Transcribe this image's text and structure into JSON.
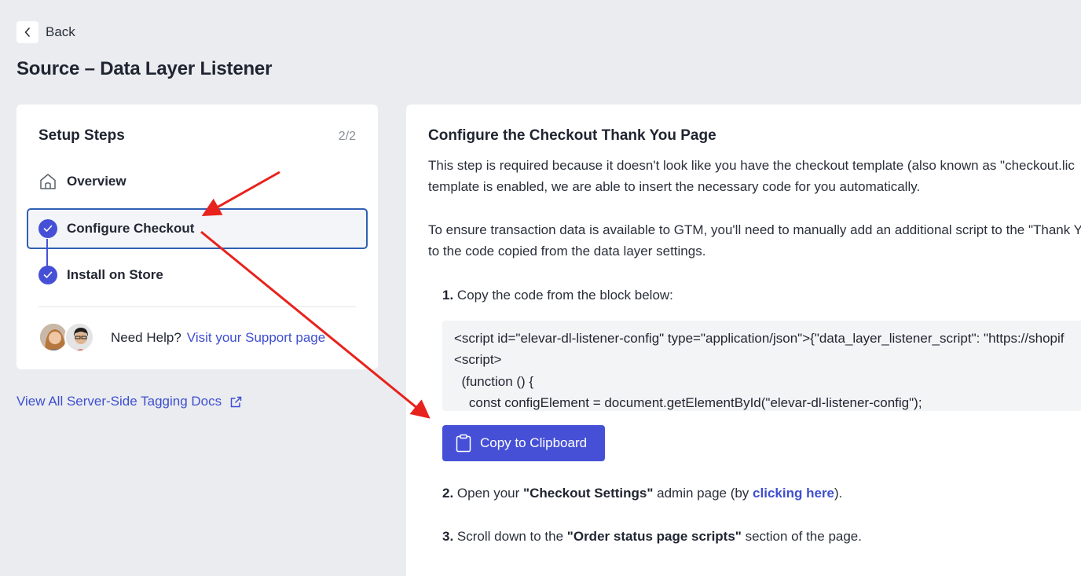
{
  "header": {
    "back_label": "Back",
    "page_title": "Source – Data Layer Listener"
  },
  "sidebar": {
    "title": "Setup Steps",
    "progress": "2/2",
    "steps": [
      {
        "label": "Overview",
        "icon": "home-icon",
        "state": "default"
      },
      {
        "label": "Configure Checkout",
        "icon": "check-circle-icon",
        "state": "active"
      },
      {
        "label": "Install on Store",
        "icon": "check-circle-icon",
        "state": "complete"
      }
    ],
    "help_text": "Need Help?",
    "help_link": "Visit your Support page",
    "docs_link": "View All Server-Side Tagging Docs"
  },
  "main": {
    "title": "Configure the Checkout Thank You Page",
    "para1_line1": "This step is required because it doesn't look like you have the checkout template (also known as \"checkout.lic",
    "para1_line2": "template is enabled, we are able to insert the necessary code for you automatically.",
    "para2_line1": "To ensure transaction data is available to GTM, you'll need to manually add an additional script to the \"Thank Y",
    "para2_line2": "to the code copied from the data layer settings.",
    "step1_num": "1.",
    "step1_text": "Copy the code from the block below:",
    "code_lines": [
      "<script id=\"elevar-dl-listener-config\" type=\"application/json\">{\"data_layer_listener_script\": \"https://shopif",
      "<script>",
      "  (function () {",
      "    const configElement = document.getElementById(\"elevar-dl-listener-config\");"
    ],
    "copy_button": "Copy to Clipboard",
    "step2_num": "2.",
    "step2_pre": "Open your ",
    "step2_bold": "\"Checkout Settings\"",
    "step2_mid": " admin page (by ",
    "step2_link": "clicking here",
    "step2_post": ").",
    "step3_num": "3.",
    "step3_pre": "Scroll down to the ",
    "step3_bold": "\"Order status page scripts\"",
    "step3_post": " section of the page."
  },
  "colors": {
    "accent": "#4650d6",
    "link": "#3f4fcf",
    "active_border": "#2f5fb3",
    "annotation": "#e8221c",
    "background": "#eaecf0"
  }
}
